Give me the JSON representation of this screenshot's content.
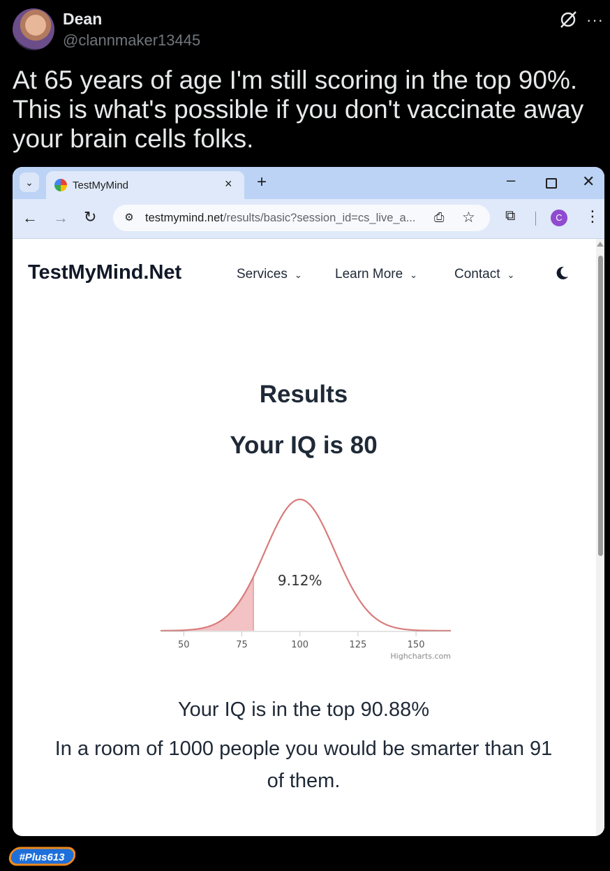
{
  "tweet": {
    "author_name": "Dean",
    "author_handle": "@clannmaker13445",
    "text": "At 65 years of age I'm still scoring in the top 90%. This is what's possible if you don't vaccinate away your brain cells folks."
  },
  "browser": {
    "tab_title": "TestMyMind",
    "tab_close": "×",
    "new_tab": "+",
    "minimize": "–",
    "close": "✕",
    "url_domain": "testmymind.net",
    "url_path": "/results/basic?session_id=cs_live_a...",
    "profile_initial": "C"
  },
  "site": {
    "logo": "TestMyMind.Net",
    "nav": [
      {
        "label": "Services"
      },
      {
        "label": "Learn More"
      },
      {
        "label": "Contact"
      }
    ],
    "results_heading": "Results",
    "iq_heading": "Your IQ is 80",
    "top_text": "Your IQ is in the top 90.88%",
    "room_text": "In a room of 1000 people you would be smarter than 91 of them."
  },
  "chart_data": {
    "type": "area",
    "distribution": "normal",
    "mean": 100,
    "sd": 15,
    "xlim": [
      40,
      165
    ],
    "shaded_range": [
      40,
      80
    ],
    "shaded_label": "9.12%",
    "x_ticks": [
      50,
      75,
      100,
      125,
      150
    ],
    "credit": "Highcharts.com",
    "line_color": "#d97b7b",
    "fill_color": "#f2c2c4"
  },
  "watermark": "#Plus613",
  "colors": {
    "tweet_bg": "#000000",
    "tab_bar": "#bcd3f5",
    "toolbar": "#dfe9f9",
    "profile": "#8f4ad0"
  }
}
